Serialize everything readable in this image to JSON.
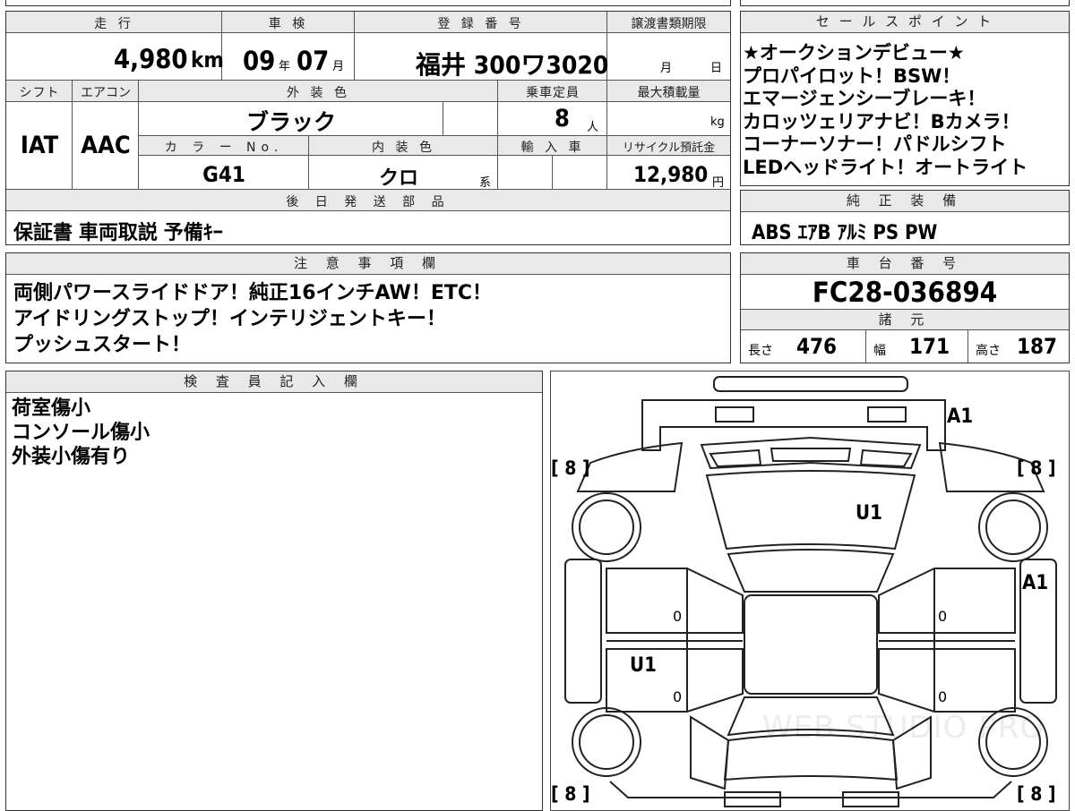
{
  "vehicle_info": {
    "mileage_label": "走 行",
    "mileage_value": "4,980",
    "mileage_unit": "km",
    "inspection_label": "車 検",
    "inspection_year": "09",
    "inspection_year_unit": "年",
    "inspection_month": "07",
    "inspection_month_unit": "月",
    "registration_label": "登 録 番 号",
    "registration_value": "福井 300ワ3020",
    "transfer_docs_label": "譲渡書類期限",
    "transfer_month_unit": "月",
    "transfer_day_unit": "日",
    "shift_label": "シフト",
    "shift_value": "IAT",
    "aircon_label": "エアコン",
    "aircon_value": "AAC",
    "exterior_color_label": "外 装 色",
    "exterior_color_value": "ブラック",
    "capacity_label": "乗車定員",
    "capacity_value": "8",
    "capacity_unit": "人",
    "max_load_label": "最大積載量",
    "max_load_unit": "kg",
    "color_no_label": "カ ラ ー No.",
    "color_no_value": "G41",
    "interior_color_label": "内 装 色",
    "interior_color_value": "クロ",
    "interior_color_suffix": "系",
    "import_label": "輸 入 車",
    "recycle_label": "リサイクル預託金",
    "recycle_value": "12,980",
    "recycle_unit": "円",
    "later_parts_label": "後 日 発 送 部 品",
    "later_parts_value": "保証書 車両取説 予備ｷｰ"
  },
  "sales_points": {
    "label": "セ ー ル ス ポ イ ン ト",
    "lines": [
      "★オークションデビュー★",
      "プロパイロット！BSW！",
      "エマージェンシーブレーキ！",
      "カロッツェリアナビ！Bカメラ！",
      "コーナーソナー！パドルシフト",
      "LEDヘッドライト！オートライト"
    ]
  },
  "genuine_equipment": {
    "label": "純 正 装 備",
    "value": "ABS ｴｱB ｱﾙﾐ PS PW"
  },
  "notes": {
    "label": "注 意 事 項 欄",
    "lines": [
      "両側パワースライドドア！純正16インチAW！ETC！",
      "アイドリングストップ！インテリジェントキー！",
      "プッシュスタート！"
    ]
  },
  "chassis": {
    "label": "車 台 番 号",
    "value": "FC28-036894"
  },
  "specs": {
    "label": "諸 元",
    "length_label": "長さ",
    "length_value": "476",
    "width_label": "幅",
    "width_value": "171",
    "height_label": "高さ",
    "height_value": "187"
  },
  "inspector": {
    "label": "検 査 員 記 入 欄",
    "lines": [
      "荷室傷小",
      "コンソール傷小",
      "外装小傷有り"
    ]
  },
  "diagram": {
    "tire_fl": "[ 8 ]",
    "tire_fr": "[ 8 ]",
    "tire_rl": "[ 8 ]",
    "tire_rr": "[ 8 ]",
    "mark_front_bumper": "A1",
    "mark_hood": "U1",
    "mark_right_front_fender": "A1",
    "mark_left_rear_door": "U1",
    "door_value_lf": "0",
    "door_value_rf": "0",
    "door_value_lr": "0",
    "door_value_rr": "0",
    "watermark": "WEB STUDIO PRO"
  }
}
